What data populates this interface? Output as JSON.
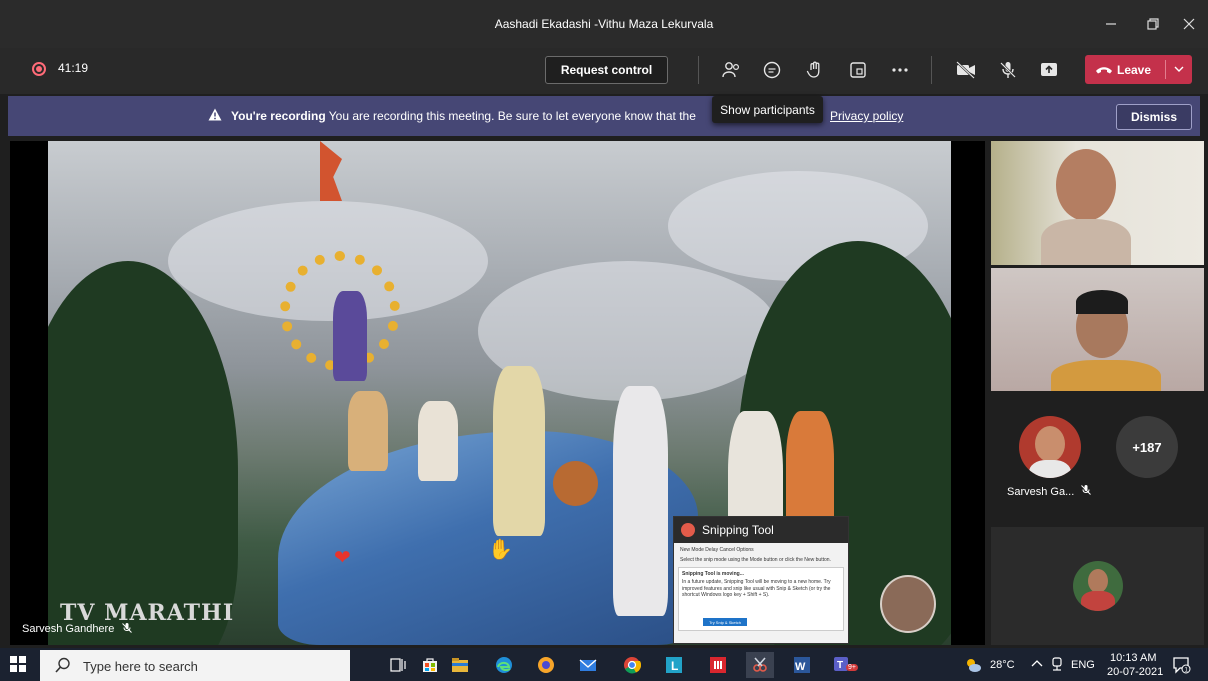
{
  "window": {
    "title": "Aashadi Ekadashi -Vithu Maza Lekurvala"
  },
  "toolbar": {
    "timer": "41:19",
    "request_control_label": "Request control",
    "leave_label": "Leave",
    "leave_color": "#c4314b"
  },
  "tooltip": {
    "text": "Show participants"
  },
  "banner": {
    "bold": "You're recording",
    "message": "You are recording this meeting. Be sure to let everyone know that the",
    "link": "Privacy policy",
    "dismiss_label": "Dismiss",
    "color": "#464775"
  },
  "stage": {
    "speaker_name": "Sarvesh Gandhere",
    "channel_logo": "TV MARATHI"
  },
  "snipping_tool": {
    "title": "Snipping Tool",
    "menu": "New   Mode   Delay   Cancel   Options",
    "hint": "Select the snip mode using the Mode button or click the New button.",
    "notice_title": "Snipping Tool is moving...",
    "notice_body": "In a future update, Snipping Tool will be moving to a new home. Try improved features and snip like usual with Snip & Sketch (or try the shortcut Windows logo key + Shift + S).",
    "notice_button": "Try Snip & Sketch"
  },
  "participants": {
    "tile_name": "Sarvesh Ga...",
    "more_count": "+187"
  },
  "taskbar": {
    "search_placeholder": "Type here to search",
    "weather": "28°C",
    "lang": "ENG",
    "time": "10:13 AM",
    "date": "20-07-2021",
    "teams_badge": "9+"
  }
}
